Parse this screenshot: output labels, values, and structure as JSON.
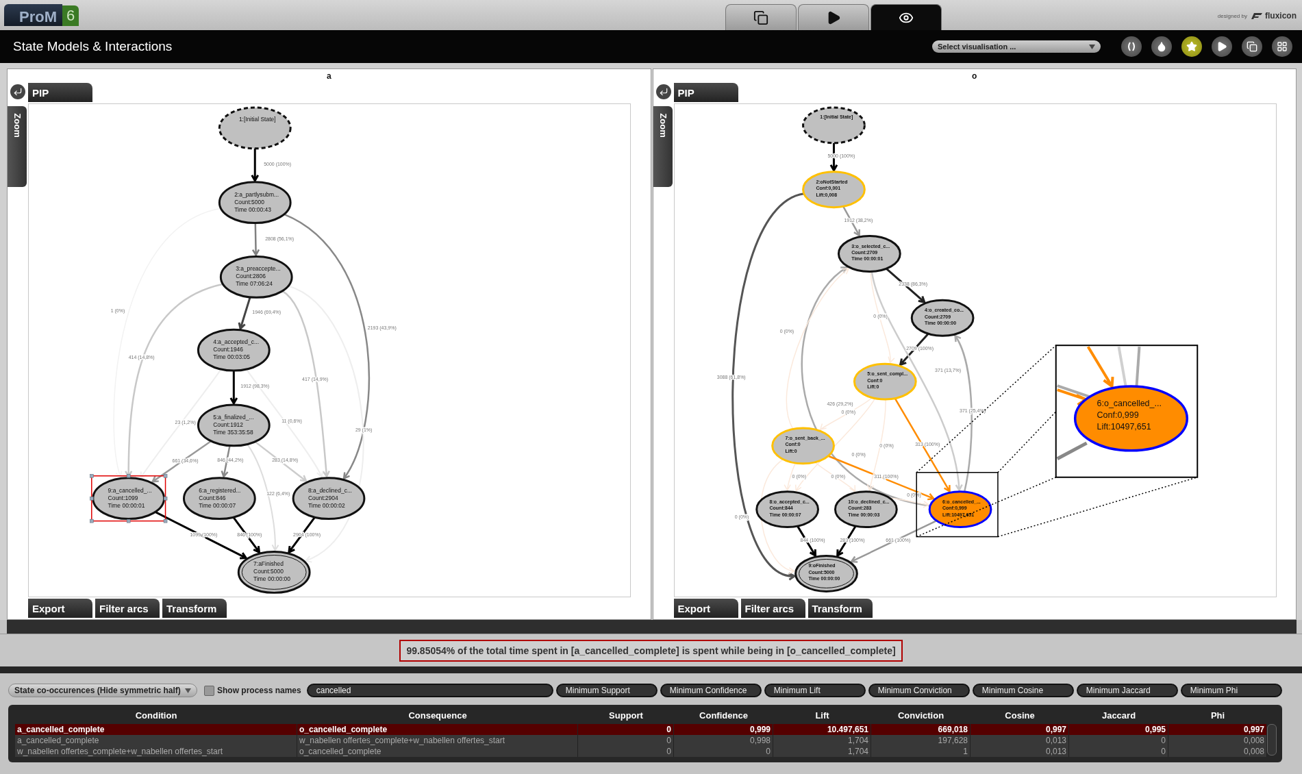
{
  "app": {
    "logo": "ProM",
    "version": "6",
    "designed_by": "designed by",
    "brand": "fluxicon"
  },
  "top_tabs": [
    {
      "kind": "copy",
      "selected": false
    },
    {
      "kind": "play",
      "selected": false
    },
    {
      "kind": "eye",
      "selected": true
    }
  ],
  "title": "State Models & Interactions",
  "visualisation_select": {
    "value": "Select visualisation ..."
  },
  "toolbar_buttons": [
    {
      "kind": "brackets",
      "active": false
    },
    {
      "kind": "drop",
      "active": false
    },
    {
      "kind": "star",
      "active": true
    },
    {
      "kind": "play",
      "active": false
    },
    {
      "kind": "copy",
      "active": false
    },
    {
      "kind": "grid",
      "active": false
    }
  ],
  "panels": [
    {
      "title": "a",
      "tab": "PIP",
      "zoom_label": "Zoom",
      "bottom_tabs": [
        "Export",
        "Filter arcs",
        "Transform"
      ],
      "graph": {
        "nodes": [
          {
            "kind": "initial",
            "selected": false,
            "lines": [
              "1:[Initial State]"
            ]
          },
          {
            "kind": "state",
            "selected": false,
            "lines": [
              "2:a_partlysubm...",
              "Count:5000",
              "Time 00:00:43"
            ]
          },
          {
            "kind": "state",
            "selected": false,
            "lines": [
              "3:a_preaccepte...",
              "Count:2806",
              "Time 07:06:24"
            ]
          },
          {
            "kind": "state",
            "selected": false,
            "lines": [
              "4:a_accepted_c...",
              "Count:1946",
              "Time 00:03:05"
            ]
          },
          {
            "kind": "state",
            "selected": false,
            "lines": [
              "5:a_finalized_...",
              "Count:1912",
              "Time 353:35:58"
            ]
          },
          {
            "kind": "state",
            "selected": true,
            "lines": [
              "9:a_cancelled_...",
              "Count:1099",
              "Time 00:00:01"
            ]
          },
          {
            "kind": "state",
            "selected": false,
            "lines": [
              "6:a_registered...",
              "Count:846",
              "Time 00:00:07"
            ]
          },
          {
            "kind": "state",
            "selected": false,
            "lines": [
              "8:a_declined_c...",
              "Count:2904",
              "Time 00:00:02"
            ]
          },
          {
            "kind": "final",
            "selected": false,
            "lines": [
              "7:aFinished",
              "Count:5000",
              "Time 00:00:00"
            ]
          }
        ],
        "edges": [
          {
            "label": "5000 (100%)",
            "color": "#000000"
          },
          {
            "label": "2808 (56,1%)",
            "color": "#808080"
          },
          {
            "label": "2193 (43,9%)",
            "color": "#888888"
          },
          {
            "label": "1946 (69,4%)",
            "color": "#444444"
          },
          {
            "label": "414 (14,8%)",
            "color": "#c8c8c8"
          },
          {
            "label": "417 (14,9%)",
            "color": "#c8c8c8"
          },
          {
            "label": "29 (1%)",
            "color": "#eeeeee"
          },
          {
            "label": "1 (0%)",
            "color": "#f2f2f2"
          },
          {
            "label": "1912 (98,3%)",
            "color": "#000000"
          },
          {
            "label": "23 (1,2%)",
            "color": "#eeeeee"
          },
          {
            "label": "11 (0,6%)",
            "color": "#eeeeee"
          },
          {
            "label": "661 (34,6%)",
            "color": "#999999"
          },
          {
            "label": "846 (44,2%)",
            "color": "#888888"
          },
          {
            "label": "283 (14,8%)",
            "color": "#cccccc"
          },
          {
            "label": "122 (6,4%)",
            "color": "#dddddd"
          },
          {
            "label": "1099 (100%)",
            "color": "#000000"
          },
          {
            "label": "846 (100%)",
            "color": "#000000"
          },
          {
            "label": "2904 (100%)",
            "color": "#000000"
          }
        ]
      }
    },
    {
      "title": "o",
      "tab": "PIP",
      "zoom_label": "Zoom",
      "bottom_tabs": [
        "Export",
        "Filter arcs",
        "Transform"
      ],
      "graph": {
        "nodes": [
          {
            "kind": "initial",
            "lines": [
              "1:[Initial State]"
            ]
          },
          {
            "kind": "related",
            "lines": [
              "2:oNotStarted",
              "Conf:0,001",
              "Lift:0,008"
            ]
          },
          {
            "kind": "state",
            "lines": [
              "3:o_selected_c...",
              "Count:2709",
              "Time 00:00:01"
            ]
          },
          {
            "kind": "state",
            "lines": [
              "4:o_created_co...",
              "Count:2709",
              "Time 00:00:00"
            ]
          },
          {
            "kind": "related",
            "lines": [
              "5:o_sent_compl...",
              "Conf:0",
              "Lift:0"
            ]
          },
          {
            "kind": "related",
            "lines": [
              "7:o_sent_back_...",
              "Conf:0",
              "Lift:0"
            ]
          },
          {
            "kind": "state",
            "lines": [
              "8:o_accepted_c...",
              "Count:844",
              "Time 00:00:07"
            ]
          },
          {
            "kind": "state",
            "lines": [
              "10:o_declined_c...",
              "Count:283",
              "Time 00:00:03"
            ]
          },
          {
            "kind": "focus",
            "lines": [
              "6:o_cancelled_...",
              "Conf:0,999",
              "Lift:10497,651"
            ]
          },
          {
            "kind": "final",
            "lines": [
              "9:oFinished",
              "Count:5000",
              "Time 00:00:00"
            ]
          }
        ],
        "edges": [
          {
            "label": "5000 (100%)",
            "color": "#000000"
          },
          {
            "label": "1912 (38,2%)",
            "color": "#999999"
          },
          {
            "label": "3088 (61,8%)",
            "color": "#555555"
          },
          {
            "label": "2338 (86,3%)",
            "color": "#222222"
          },
          {
            "label": "2709 (100%)",
            "color": "#222222"
          },
          {
            "label": "371 (13,7%)",
            "color": "#cccccc"
          },
          {
            "label": "371 (25,4%)",
            "color": "#aaaaaa"
          },
          {
            "label": "426 (29,2%)",
            "color": "#aaaaaa"
          },
          {
            "label": "313 (100%)",
            "color": "#ff8c00"
          },
          {
            "label": "311 (100%)",
            "color": "#ff8c00"
          },
          {
            "label": "844 (100%)",
            "color": "#000000"
          },
          {
            "label": "283 (100%)",
            "color": "#000000"
          },
          {
            "label": "661 (100%)",
            "color": "#999999"
          },
          {
            "label": "0 (0%)",
            "color": "#fbe9dc"
          },
          {
            "label": "0 (0%)",
            "color": "#fbe9dc"
          },
          {
            "label": "0 (0%)",
            "color": "#fbe9dc"
          },
          {
            "label": "0 (0%)",
            "color": "#fbe9dc"
          },
          {
            "label": "0 (0%)",
            "color": "#fbe9dc"
          },
          {
            "label": "0 (0%)",
            "color": "#fbe9dc"
          },
          {
            "label": "0 (0%)",
            "color": "#fbe9dc"
          },
          {
            "label": "0 (0%)",
            "color": "#fbe9dc"
          },
          {
            "label": "0 (0%)",
            "color": "#fbe9dc"
          }
        ]
      },
      "inset": {
        "lines": [
          "6:o_cancelled_...",
          "Conf:0,999",
          "Lift:10497,651"
        ]
      }
    }
  ],
  "message": "99.85054% of the total time spent in [a_cancelled_complete] is spent while being in [o_cancelled_complete]",
  "filters": {
    "mode": "State co-occurences (Hide symmetric half)",
    "show_process_names": {
      "label": "Show process names",
      "checked": false
    },
    "search": "cancelled",
    "thresholds": [
      {
        "placeholder": "Minimum Support"
      },
      {
        "placeholder": "Minimum Confidence"
      },
      {
        "placeholder": "Minimum Lift"
      },
      {
        "placeholder": "Minimum Conviction"
      },
      {
        "placeholder": "Minimum Cosine"
      },
      {
        "placeholder": "Minimum Jaccard"
      },
      {
        "placeholder": "Minimum Phi"
      }
    ]
  },
  "table": {
    "columns": [
      "Condition",
      "Consequence",
      "Support",
      "Confidence",
      "Lift",
      "Conviction",
      "Cosine",
      "Jaccard",
      "Phi"
    ],
    "rows": [
      {
        "selected": true,
        "cells": [
          "a_cancelled_complete",
          "o_cancelled_complete",
          "0",
          "0,999",
          "10.497,651",
          "669,018",
          "0,997",
          "0,995",
          "0,997"
        ]
      },
      {
        "selected": false,
        "cells": [
          "a_cancelled_complete",
          "w_nabellen offertes_complete+w_nabellen offertes_start",
          "0",
          "0,998",
          "1,704",
          "197,628",
          "0,013",
          "0",
          "0,008"
        ]
      },
      {
        "selected": false,
        "cells": [
          "w_nabellen offertes_complete+w_nabellen offertes_start",
          "o_cancelled_complete",
          "0",
          "0",
          "1,704",
          "1",
          "0,013",
          "0",
          "0,008"
        ]
      }
    ]
  }
}
